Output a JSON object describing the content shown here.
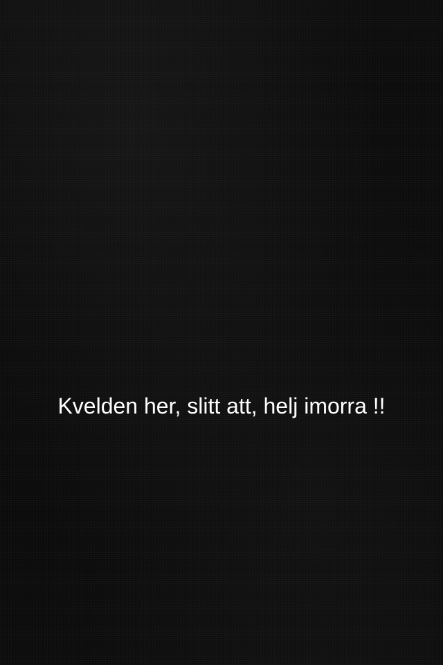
{
  "snap": {
    "caption_text": "Kvelden her, slitt att, helj imorra !!",
    "background_color": "#0b0b0b",
    "caption_color": "#ffffff"
  }
}
